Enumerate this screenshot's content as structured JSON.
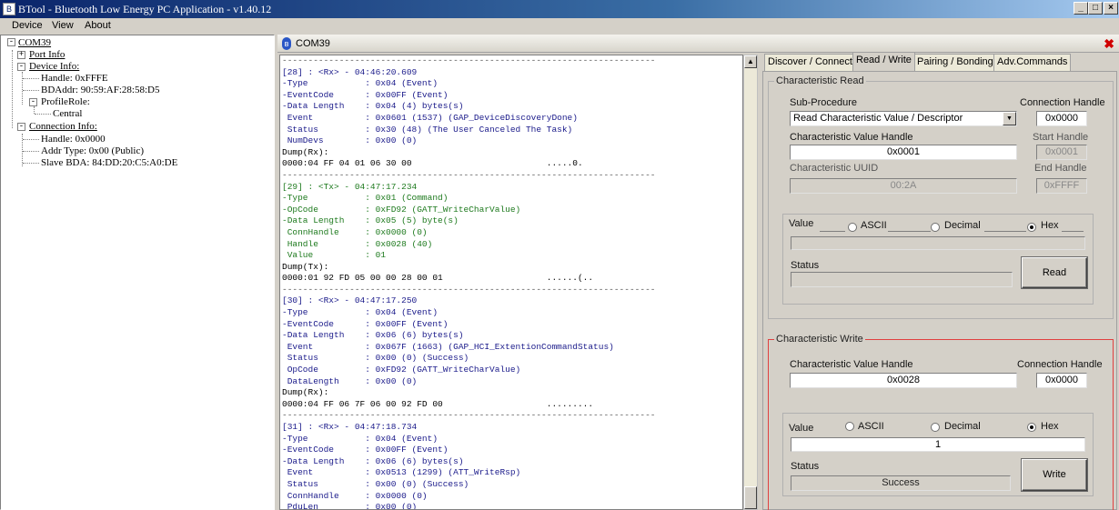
{
  "window": {
    "title": "BTool - Bluetooth Low Energy PC Application - v1.40.12",
    "minimize": "_",
    "maximize": "□",
    "close": "×"
  },
  "menu": [
    "Device",
    "View",
    "About"
  ],
  "tree": {
    "root": "COM39",
    "port_info": "Port Info",
    "device_info": "Device Info:",
    "handle": "Handle: 0xFFFE",
    "bdaddr": "BDAddr: 90:59:AF:28:58:D5",
    "profile_role": "ProfileRole:",
    "central": "Central",
    "connection_info": "Connection Info:",
    "conn_handle": "Handle: 0x0000",
    "addr_type": "Addr Type: 0x00 (Public)",
    "slave_bda": "Slave BDA: 84:DD:20:C5:A0:DE"
  },
  "doc_tab": {
    "label": "COM39",
    "bt_icon": "bluetooth-icon",
    "close": "✖"
  },
  "log": [
    {
      "t": "sep",
      "text": "------------------------------------------------------------------------"
    },
    {
      "t": "rx",
      "text": "[28] : <Rx> - 04:46:20.609"
    },
    {
      "t": "rx",
      "text": "-Type           : 0x04 (Event)"
    },
    {
      "t": "rx",
      "text": "-EventCode      : 0x00FF (Event)"
    },
    {
      "t": "rx",
      "text": "-Data Length    : 0x04 (4) bytes(s)"
    },
    {
      "t": "rx",
      "text": " Event          : 0x0601 (1537) (GAP_DeviceDiscoveryDone)"
    },
    {
      "t": "rx",
      "text": " Status         : 0x30 (48) (The User Canceled The Task)"
    },
    {
      "t": "rx",
      "text": " NumDevs        : 0x00 (0)"
    },
    {
      "t": "d",
      "text": "Dump(Rx):"
    },
    {
      "t": "d",
      "text": "0000:04 FF 04 01 06 30 00                          .....0."
    },
    {
      "t": "sep",
      "text": "------------------------------------------------------------------------"
    },
    {
      "t": "tx",
      "text": "[29] : <Tx> - 04:47:17.234"
    },
    {
      "t": "tx",
      "text": "-Type           : 0x01 (Command)"
    },
    {
      "t": "tx",
      "text": "-OpCode         : 0xFD92 (GATT_WriteCharValue)"
    },
    {
      "t": "tx",
      "text": "-Data Length    : 0x05 (5) byte(s)"
    },
    {
      "t": "tx",
      "text": " ConnHandle     : 0x0000 (0)"
    },
    {
      "t": "tx",
      "text": " Handle         : 0x0028 (40)"
    },
    {
      "t": "tx",
      "text": " Value          : 01"
    },
    {
      "t": "d",
      "text": "Dump(Tx):"
    },
    {
      "t": "d",
      "text": "0000:01 92 FD 05 00 00 28 00 01                    ......(.."
    },
    {
      "t": "sep",
      "text": "------------------------------------------------------------------------"
    },
    {
      "t": "rx",
      "text": "[30] : <Rx> - 04:47:17.250"
    },
    {
      "t": "rx",
      "text": "-Type           : 0x04 (Event)"
    },
    {
      "t": "rx",
      "text": "-EventCode      : 0x00FF (Event)"
    },
    {
      "t": "rx",
      "text": "-Data Length    : 0x06 (6) bytes(s)"
    },
    {
      "t": "rx",
      "text": " Event          : 0x067F (1663) (GAP_HCI_ExtentionCommandStatus)"
    },
    {
      "t": "rx",
      "text": " Status         : 0x00 (0) (Success)"
    },
    {
      "t": "rx",
      "text": " OpCode         : 0xFD92 (GATT_WriteCharValue)"
    },
    {
      "t": "rx",
      "text": " DataLength     : 0x00 (0)"
    },
    {
      "t": "d",
      "text": "Dump(Rx):"
    },
    {
      "t": "d",
      "text": "0000:04 FF 06 7F 06 00 92 FD 00                    ........."
    },
    {
      "t": "sep",
      "text": "------------------------------------------------------------------------"
    },
    {
      "t": "rx",
      "text": "[31] : <Rx> - 04:47:18.734"
    },
    {
      "t": "rx",
      "text": "-Type           : 0x04 (Event)"
    },
    {
      "t": "rx",
      "text": "-EventCode      : 0x00FF (Event)"
    },
    {
      "t": "rx",
      "text": "-Data Length    : 0x06 (6) bytes(s)"
    },
    {
      "t": "rx",
      "text": " Event          : 0x0513 (1299) (ATT_WriteRsp)"
    },
    {
      "t": "rx",
      "text": " Status         : 0x00 (0) (Success)"
    },
    {
      "t": "rx",
      "text": " ConnHandle     : 0x0000 (0)"
    },
    {
      "t": "rx",
      "text": " PduLen         : 0x00 (0)"
    }
  ],
  "tabs": [
    "Discover / Connect",
    "Read / Write",
    "Pairing / Bonding",
    "Adv.Commands"
  ],
  "char_read": {
    "title": "Characteristic Read",
    "sub_procedure_label": "Sub-Procedure",
    "sub_procedure_value": "Read Characteristic Value / Descriptor",
    "conn_handle_label": "Connection Handle",
    "conn_handle_value": "0x0000",
    "value_handle_label": "Characteristic Value Handle",
    "value_handle_value": "0x0001",
    "start_handle_label": "Start Handle",
    "start_handle_value": "0x0001",
    "uuid_label": "Characteristic UUID",
    "uuid_value": "00:2A",
    "end_handle_label": "End Handle",
    "end_handle_value": "0xFFFF",
    "value_label": "Value",
    "ascii": "ASCII",
    "decimal": "Decimal",
    "hex": "Hex",
    "value_value": "",
    "status_label": "Status",
    "status_value": "",
    "read_button": "Read"
  },
  "char_write": {
    "title": "Characteristic Write",
    "value_handle_label": "Characteristic Value Handle",
    "value_handle_value": "0x0028",
    "conn_handle_label": "Connection Handle",
    "conn_handle_value": "0x0000",
    "value_label": "Value",
    "ascii": "ASCII",
    "decimal": "Decimal",
    "hex": "Hex",
    "value_value": "1",
    "status_label": "Status",
    "status_value": "Success",
    "write_button": "Write"
  },
  "colors": {
    "rx": "#1a1a8a",
    "tx": "#1e7a1e",
    "highlight": "#e04040",
    "title_bar": "#0a246a"
  }
}
